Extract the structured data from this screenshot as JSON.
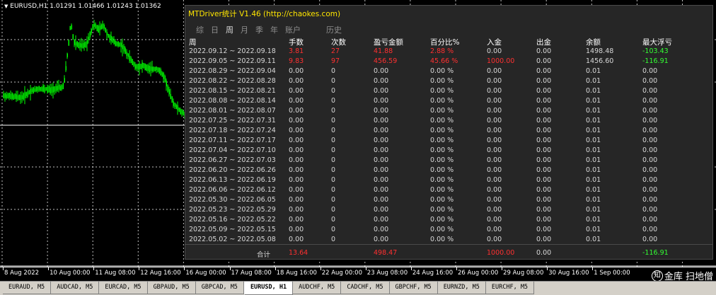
{
  "chart": {
    "title": "EURUSD,H1  1.01291 1.01466 1.01243 1.01362",
    "candle_color": "#00ff00",
    "grid_color": "#ffffff",
    "background": "#000000"
  },
  "time_axis": [
    "8 Aug 2022",
    "10 Aug 00:00",
    "11 Aug 08:00",
    "12 Aug 16:00",
    "16 Aug 00:00",
    "17 Aug 08:00",
    "18 Aug 16:00",
    "22 Aug 00:00",
    "23 Aug 08:00",
    "24 Aug 16:00",
    "26 Aug 00:00",
    "29 Aug 08:00",
    "30 Aug 16:00",
    "1 Sep 00:00"
  ],
  "watermark": {
    "logo": "知",
    "text": "金库 扫地僧"
  },
  "panel": {
    "title": "MTDriver统计 V1.46  (http://chaokes.com)",
    "tabs": [
      "综",
      "日",
      "周",
      "月",
      "季",
      "年",
      "账户",
      "历史"
    ],
    "active_tab": "周",
    "headers": [
      "周",
      "手数",
      "次数",
      "盈亏金额",
      "百分比%",
      "入金",
      "出金",
      "余额",
      "最大浮亏"
    ],
    "rows": [
      [
        "2022.09.12 ~ 2022.09.18",
        "3.81",
        "27",
        "41.88",
        "2.88 %",
        "0.00",
        "0.00",
        "1498.48",
        "-103.43"
      ],
      [
        "2022.09.05 ~ 2022.09.11",
        "9.83",
        "97",
        "456.59",
        "45.66 %",
        "1000.00",
        "0.00",
        "1456.60",
        "-116.91"
      ],
      [
        "2022.08.29 ~ 2022.09.04",
        "0.00",
        "0",
        "0.00",
        "0.00 %",
        "0.00",
        "0.00",
        "0.01",
        "0.00"
      ],
      [
        "2022.08.22 ~ 2022.08.28",
        "0.00",
        "0",
        "0.00",
        "0.00 %",
        "0.00",
        "0.00",
        "0.01",
        "0.00"
      ],
      [
        "2022.08.15 ~ 2022.08.21",
        "0.00",
        "0",
        "0.00",
        "0.00 %",
        "0.00",
        "0.00",
        "0.01",
        "0.00"
      ],
      [
        "2022.08.08 ~ 2022.08.14",
        "0.00",
        "0",
        "0.00",
        "0.00 %",
        "0.00",
        "0.00",
        "0.01",
        "0.00"
      ],
      [
        "2022.08.01 ~ 2022.08.07",
        "0.00",
        "0",
        "0.00",
        "0.00 %",
        "0.00",
        "0.00",
        "0.01",
        "0.00"
      ],
      [
        "2022.07.25 ~ 2022.07.31",
        "0.00",
        "0",
        "0.00",
        "0.00 %",
        "0.00",
        "0.00",
        "0.01",
        "0.00"
      ],
      [
        "2022.07.18 ~ 2022.07.24",
        "0.00",
        "0",
        "0.00",
        "0.00 %",
        "0.00",
        "0.00",
        "0.01",
        "0.00"
      ],
      [
        "2022.07.11 ~ 2022.07.17",
        "0.00",
        "0",
        "0.00",
        "0.00 %",
        "0.00",
        "0.00",
        "0.01",
        "0.00"
      ],
      [
        "2022.07.04 ~ 2022.07.10",
        "0.00",
        "0",
        "0.00",
        "0.00 %",
        "0.00",
        "0.00",
        "0.01",
        "0.00"
      ],
      [
        "2022.06.27 ~ 2022.07.03",
        "0.00",
        "0",
        "0.00",
        "0.00 %",
        "0.00",
        "0.00",
        "0.01",
        "0.00"
      ],
      [
        "2022.06.20 ~ 2022.06.26",
        "0.00",
        "0",
        "0.00",
        "0.00 %",
        "0.00",
        "0.00",
        "0.01",
        "0.00"
      ],
      [
        "2022.06.13 ~ 2022.06.19",
        "0.00",
        "0",
        "0.00",
        "0.00 %",
        "0.00",
        "0.00",
        "0.01",
        "0.00"
      ],
      [
        "2022.06.06 ~ 2022.06.12",
        "0.00",
        "0",
        "0.00",
        "0.00 %",
        "0.00",
        "0.00",
        "0.01",
        "0.00"
      ],
      [
        "2022.05.30 ~ 2022.06.05",
        "0.00",
        "0",
        "0.00",
        "0.00 %",
        "0.00",
        "0.00",
        "0.01",
        "0.00"
      ],
      [
        "2022.05.23 ~ 2022.05.29",
        "0.00",
        "0",
        "0.00",
        "0.00 %",
        "0.00",
        "0.00",
        "0.01",
        "0.00"
      ],
      [
        "2022.05.16 ~ 2022.05.22",
        "0.00",
        "0",
        "0.00",
        "0.00 %",
        "0.00",
        "0.00",
        "0.01",
        "0.00"
      ],
      [
        "2022.05.09 ~ 2022.05.15",
        "0.00",
        "0",
        "0.00",
        "0.00 %",
        "0.00",
        "0.00",
        "0.01",
        "0.00"
      ],
      [
        "2022.05.02 ~ 2022.05.08",
        "0.00",
        "0",
        "0.00",
        "0.00 %",
        "0.00",
        "0.00",
        "0.01",
        "0.00"
      ]
    ],
    "total": {
      "label": "合计",
      "lots": "13.64",
      "profit": "498.47",
      "deposit": "1000.00",
      "withdraw": "0.00",
      "max_drawdown": "-116.91"
    },
    "colors": {
      "title": "#ffe600",
      "positive": "#ff3030",
      "negative": "#33ff33",
      "text": "#d8d8d8"
    }
  },
  "symbol_tabs": [
    "EURAUD, M5",
    "AUDCAD, M5",
    "EURCAD, M5",
    "GBPAUD, M5",
    "GBPCAD, M5",
    "EURUSD, H1",
    "AUDCHF, M5",
    "CADCHF, M5",
    "GBPCHF, M5",
    "EURNZD, M5",
    "EURCHF, M5"
  ],
  "active_symbol_tab": "EURUSD, H1"
}
